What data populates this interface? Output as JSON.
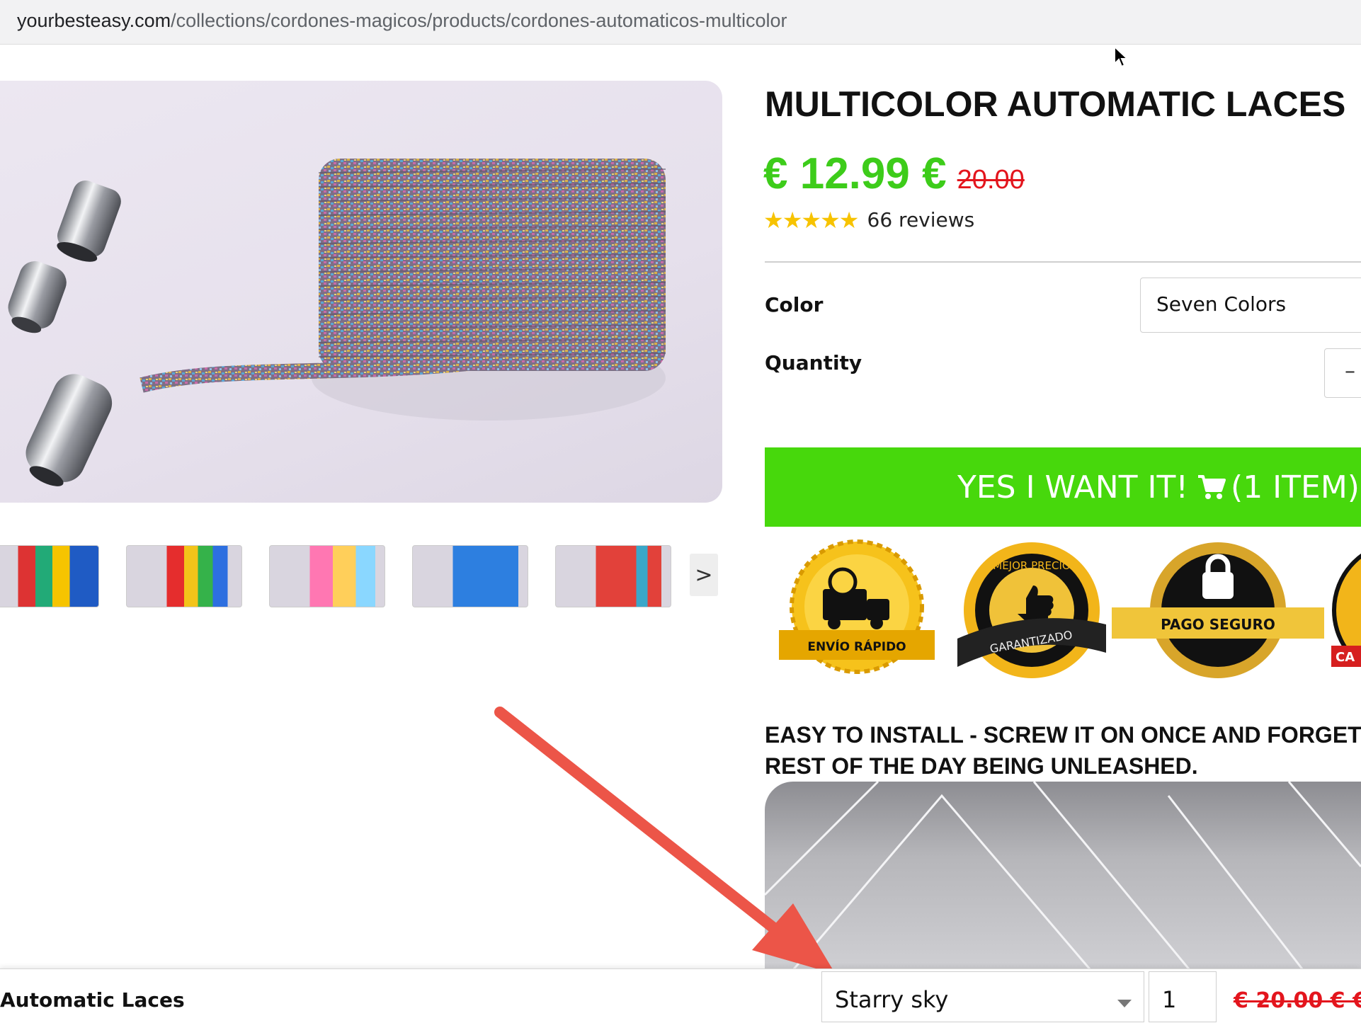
{
  "browser": {
    "url_host": "yourbesteasy.com",
    "url_path": "/collections/cordones-magicos/products/cordones-automaticos-multicolor"
  },
  "product": {
    "title": "MULTICOLOR AUTOMATIC LACES",
    "price_now": "€ 12.99 €",
    "price_old": "20.00",
    "rating_stars": 5,
    "reviews": "66 reviews",
    "color_label": "Color",
    "color_value": "Seven Colors",
    "quantity_label": "Quantity",
    "qty_minus": "–",
    "buy_label": "YES I WANT IT!",
    "buy_items": "(1 ITEM)",
    "thumb_next": ">"
  },
  "badges": {
    "fast_shipping": "ENVÍO RÁPIDO",
    "best_price_top": "MEJOR PRECIO",
    "best_price_bottom": "GARANTIZADO",
    "secure_payment": "PAGO SEGURO",
    "fourth_partial": "CA"
  },
  "content": {
    "headline_line1": "EASY TO INSTALL - SCREW IT ON ONCE AND FORGET",
    "headline_line2": "REST OF THE DAY BEING UNLEASHED."
  },
  "sticky_bar": {
    "title": "Automatic Laces",
    "variant": "Starry sky",
    "quantity": "1",
    "price": "€ 20.00 € €"
  },
  "colors": {
    "accent_green": "#47d80c",
    "price_green": "#3dcc1a",
    "sale_red": "#e3151d",
    "star_yellow": "#f7c300",
    "arrow_red": "#ec5548"
  }
}
